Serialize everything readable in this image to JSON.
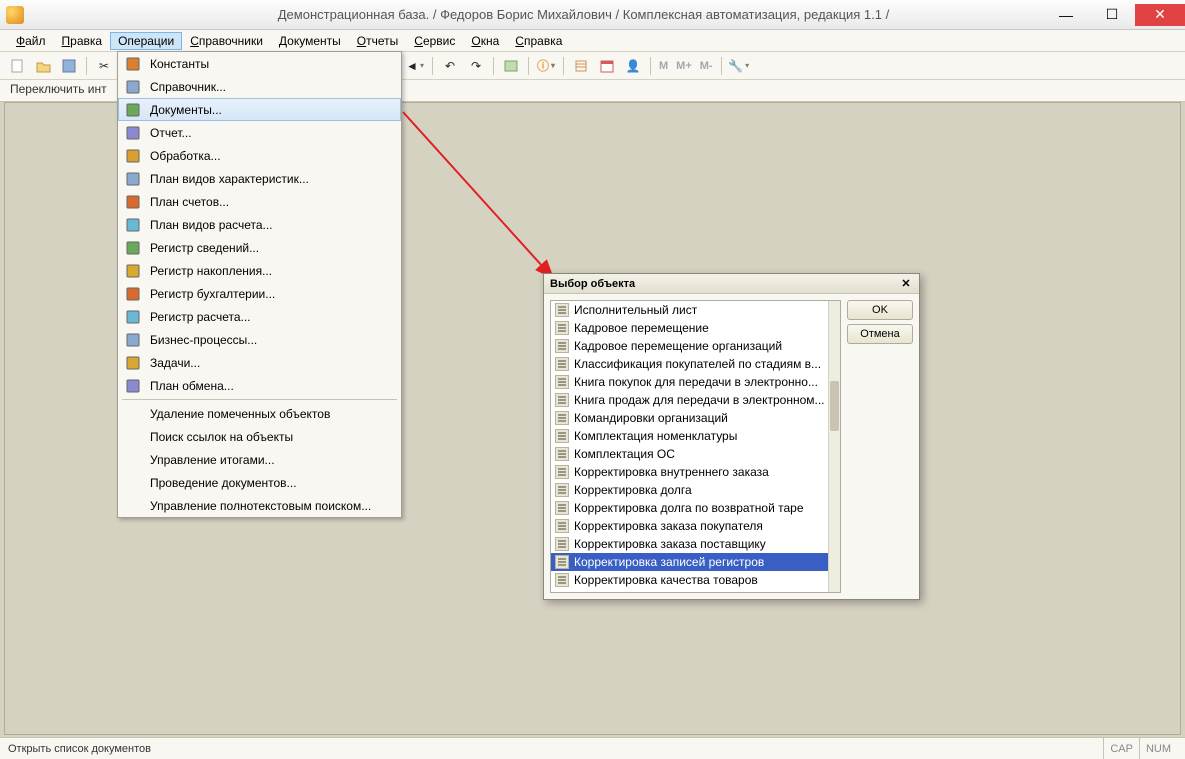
{
  "title": "Демонстрационная база. /  Федоров Борис Михайлович  /  Комплексная автоматизация, редакция 1.1  /",
  "menu": [
    "Файл",
    "Правка",
    "Операции",
    "Справочники",
    "Документы",
    "Отчеты",
    "Сервис",
    "Окна",
    "Справка"
  ],
  "menu_underline_idx": [
    0,
    0,
    -1,
    0,
    0,
    0,
    0,
    0,
    0
  ],
  "active_menu": "Операции",
  "switchbar": "Переключить инт",
  "dropdown": {
    "items": [
      {
        "icon": "const",
        "label": "Константы"
      },
      {
        "icon": "ref",
        "label": "Справочник..."
      },
      {
        "icon": "doc",
        "label": "Документы...",
        "highlighted": true
      },
      {
        "icon": "rep",
        "label": "Отчет..."
      },
      {
        "icon": "proc",
        "label": "Обработка..."
      },
      {
        "icon": "char",
        "label": "План видов характеристик..."
      },
      {
        "icon": "acct",
        "label": "План счетов..."
      },
      {
        "icon": "calc",
        "label": "План видов расчета..."
      },
      {
        "icon": "reg1",
        "label": "Регистр сведений..."
      },
      {
        "icon": "reg2",
        "label": "Регистр накопления..."
      },
      {
        "icon": "reg3",
        "label": "Регистр бухгалтерии..."
      },
      {
        "icon": "reg4",
        "label": "Регистр расчета..."
      },
      {
        "icon": "bp",
        "label": "Бизнес-процессы..."
      },
      {
        "icon": "task",
        "label": "Задачи..."
      },
      {
        "icon": "exch",
        "label": "План обмена..."
      }
    ],
    "items2": [
      "Удаление помеченных объектов",
      "Поиск ссылок на объекты",
      "Управление итогами...",
      "Проведение документов...",
      "Управление полнотекстовым поиском..."
    ]
  },
  "dialog": {
    "title": "Выбор объекта",
    "items": [
      "Исполнительный лист",
      "Кадровое перемещение",
      "Кадровое перемещение организаций",
      "Классификация покупателей по стадиям в...",
      "Книга покупок для передачи в электронно...",
      "Книга продаж для передачи в электронном...",
      "Командировки организаций",
      "Комплектация номенклатуры",
      "Комплектация ОС",
      "Корректировка внутреннего заказа",
      "Корректировка долга",
      "Корректировка долга по возвратной таре",
      "Корректировка заказа покупателя",
      "Корректировка заказа поставщику",
      "Корректировка записей регистров",
      "Корректировка качества товаров"
    ],
    "selected_index": 14,
    "ok": "OK",
    "cancel": "Отмена"
  },
  "status": {
    "text": "Открыть список документов",
    "cap": "CAP",
    "num": "NUM"
  },
  "toolbar": {
    "m": "M",
    "mplus": "M+",
    "mminus": "M-"
  }
}
